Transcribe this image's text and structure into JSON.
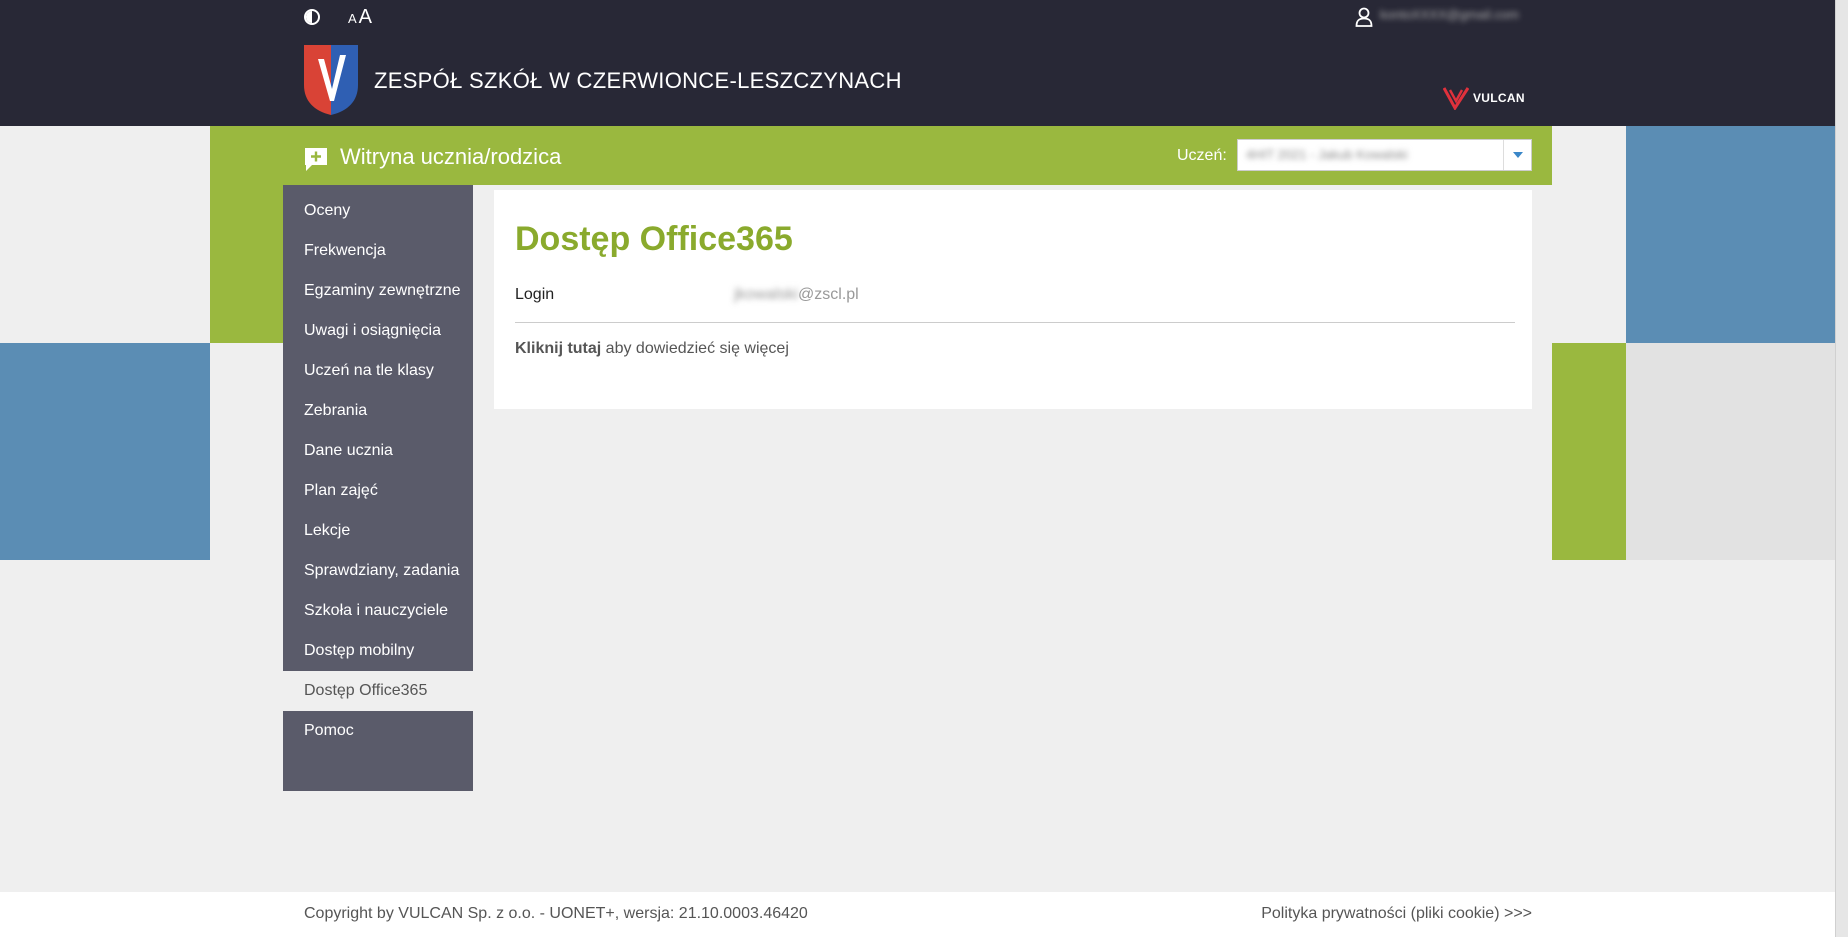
{
  "header": {
    "font_size_small": "A",
    "font_size_big": "A",
    "user_name": "kontoXXXX@gmail.com",
    "school_name": "ZESPÓŁ SZKÓŁ W CZERWIONCE-LESZCZYNACH",
    "vendor_logo_text": "VULCAN"
  },
  "app_bar": {
    "title": "Witryna ucznia/rodzica",
    "student_label": "Uczeń:",
    "student_value": "4HIT 2021 - Jakub Kowalski"
  },
  "sidebar": {
    "items": [
      {
        "label": "Oceny"
      },
      {
        "label": "Frekwencja"
      },
      {
        "label": "Egzaminy zewnętrzne"
      },
      {
        "label": "Uwagi i osiągnięcia"
      },
      {
        "label": "Uczeń na tle klasy"
      },
      {
        "label": "Zebrania"
      },
      {
        "label": "Dane ucznia"
      },
      {
        "label": "Plan zajęć"
      },
      {
        "label": "Lekcje"
      },
      {
        "label": "Sprawdziany, zadania"
      },
      {
        "label": "Szkoła i nauczyciele"
      },
      {
        "label": "Dostęp mobilny"
      },
      {
        "label": "Dostęp Office365"
      },
      {
        "label": "Pomoc"
      }
    ],
    "active_index": 12
  },
  "main": {
    "title": "Dostęp Office365",
    "login_label": "Login",
    "login_user_blurred": "jkowalski",
    "login_domain": "@zscl.pl",
    "more_link": "Kliknij tutaj",
    "more_suffix": " aby dowiedzieć się więcej"
  },
  "footer": {
    "copyright": "Copyright by VULCAN Sp. z o.o. - UONET+, wersja: 21.10.0003.46420",
    "privacy": "Polityka prywatności (pliki cookie) >>>"
  },
  "colors": {
    "header_bg": "#282836",
    "accent_green": "#9ab83f",
    "accent_blue": "#5b8db4",
    "sidebar_bg": "#5a5b6a",
    "title_green": "#8aaa2d"
  }
}
